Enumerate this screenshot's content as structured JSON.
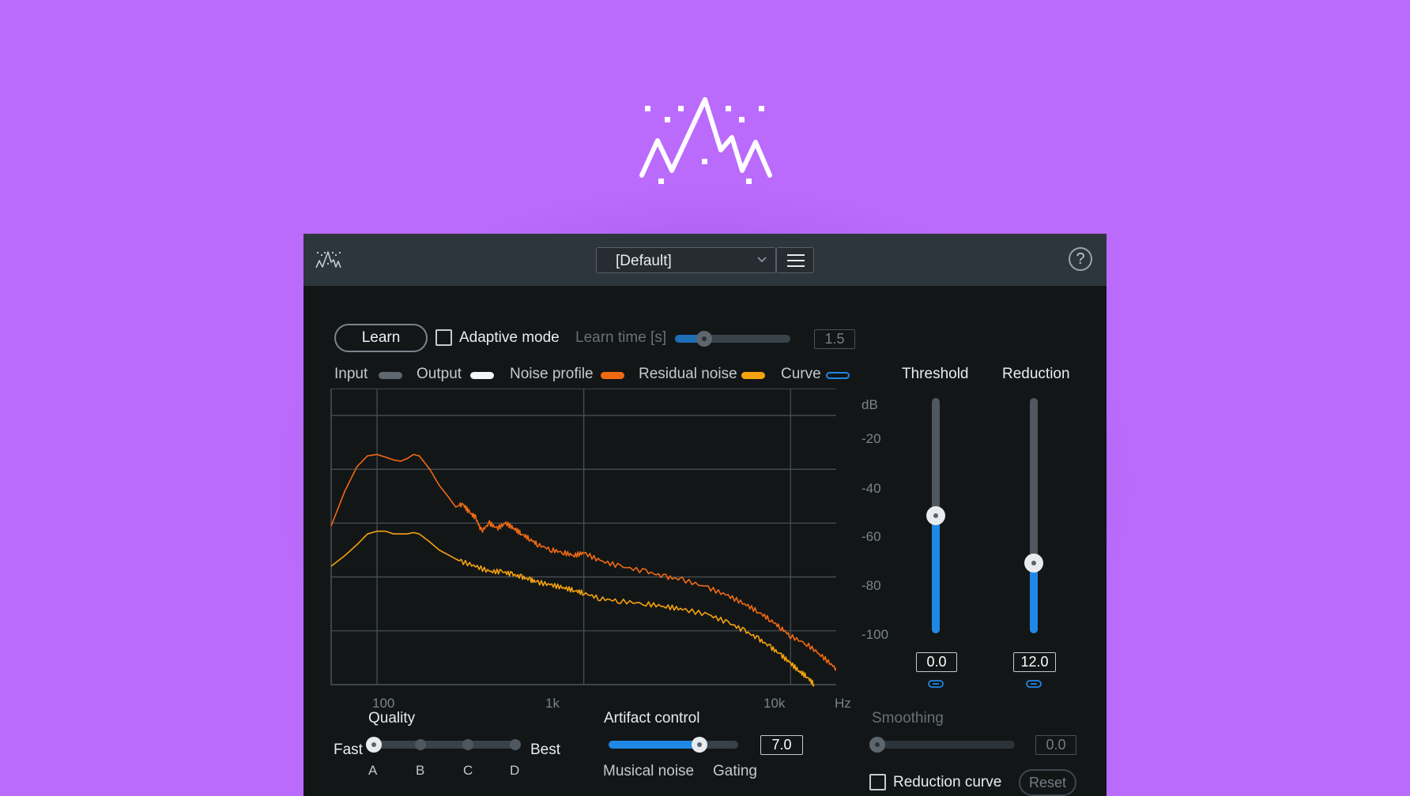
{
  "preset": {
    "selected": "[Default]"
  },
  "controls": {
    "learn_label": "Learn",
    "adaptive_mode_label": "Adaptive mode",
    "adaptive_mode_checked": false,
    "learn_time_label": "Learn time [s]",
    "learn_time_value": "1.5"
  },
  "legend": [
    {
      "label": "Input",
      "color": "#5f686f"
    },
    {
      "label": "Output",
      "color": "#f3f5f6"
    },
    {
      "label": "Noise profile",
      "color": "#f06a13"
    },
    {
      "label": "Residual noise",
      "color": "#f5a30c"
    },
    {
      "label": "Curve",
      "color": "#1f88e5"
    }
  ],
  "sliders": {
    "threshold_label": "Threshold",
    "threshold_value": "0.0",
    "threshold_level": 0.5,
    "reduction_label": "Reduction",
    "reduction_value": "12.0",
    "reduction_level": 0.3
  },
  "quality": {
    "label": "Quality",
    "min_label": "Fast",
    "max_label": "Best",
    "options": [
      "A",
      "B",
      "C",
      "D"
    ],
    "selected": "A"
  },
  "artifact": {
    "label": "Artifact control",
    "value": "7.0",
    "level": 0.7,
    "left_label": "Musical noise",
    "right_label": "Gating"
  },
  "smoothing": {
    "label": "Smoothing",
    "value": "0.0",
    "reduction_curve_label": "Reduction curve",
    "reset_label": "Reset"
  },
  "chart_data": {
    "type": "line",
    "xscale": "log",
    "xlim": [
      60,
      20000
    ],
    "ylim": [
      -120,
      -10
    ],
    "x_tick_labels": [
      "100",
      "1k",
      "10k",
      "Hz"
    ],
    "y_tick_labels": [
      "dB",
      "-20",
      "-40",
      "-60",
      "-80",
      "-100"
    ],
    "y_ticks": [
      -20,
      -40,
      -60,
      -80,
      -100
    ],
    "grid": true,
    "series": [
      {
        "name": "Noise profile",
        "color": "#f06a13",
        "x": [
          60,
          70,
          80,
          90,
          100,
          110,
          120,
          130,
          140,
          150,
          160,
          180,
          200,
          220,
          240,
          260,
          280,
          300,
          320,
          350,
          380,
          420,
          460,
          500,
          550,
          600,
          700,
          800,
          900,
          1000,
          1200,
          1500,
          2000,
          2500,
          3000,
          4000,
          5000,
          6000,
          7000,
          8000,
          9000,
          10000,
          12000,
          14000,
          16000,
          18000
        ],
        "values": [
          -61,
          -48,
          -39,
          -35,
          -34.5,
          -35.5,
          -36.5,
          -37,
          -36,
          -34.5,
          -35,
          -40,
          -46,
          -50,
          -54,
          -53,
          -56,
          -58,
          -63,
          -60,
          -62,
          -60,
          -62,
          -64,
          -66,
          -68,
          -70,
          -71,
          -72,
          -71,
          -74,
          -76,
          -78,
          -80,
          -81,
          -84,
          -87,
          -90,
          -93,
          -96,
          -99,
          -102,
          -105,
          -109,
          -113,
          -117
        ]
      },
      {
        "name": "Residual noise",
        "color": "#f5a30c",
        "x": [
          60,
          70,
          80,
          90,
          100,
          110,
          120,
          130,
          140,
          150,
          160,
          180,
          200,
          250,
          300,
          350,
          400,
          450,
          500,
          550,
          600,
          700,
          800,
          900,
          1000,
          1200,
          1500,
          2000,
          2500,
          3000,
          4000,
          5000,
          6000,
          7000,
          8000,
          9000,
          10000,
          11000,
          12000,
          13000
        ],
        "values": [
          -76,
          -72,
          -68,
          -64,
          -63,
          -63,
          -64,
          -64,
          -64,
          -63.5,
          -64,
          -67,
          -70,
          -74,
          -76,
          -78,
          -78,
          -79,
          -80,
          -81,
          -82,
          -83,
          -84,
          -85,
          -86,
          -88,
          -89,
          -90,
          -91,
          -92,
          -94,
          -97,
          -100,
          -103,
          -106,
          -109,
          -112,
          -115,
          -117,
          -120
        ]
      }
    ]
  }
}
